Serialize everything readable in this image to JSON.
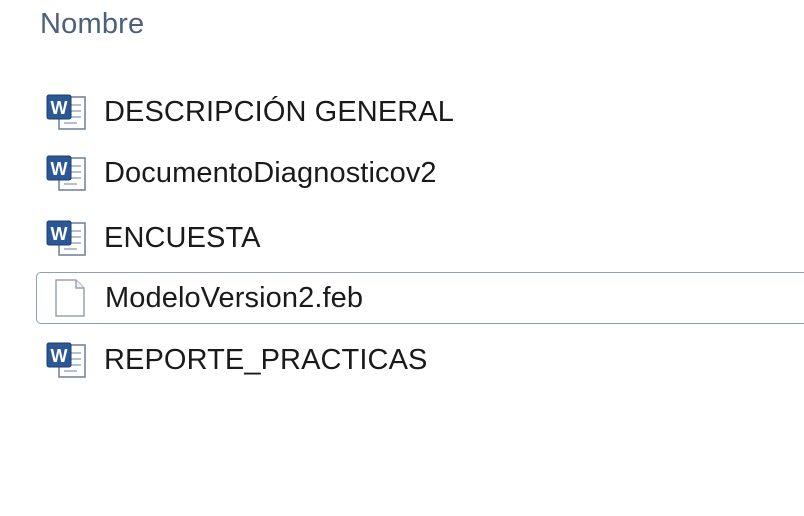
{
  "column_header": {
    "name_label": "Nombre"
  },
  "files": [
    {
      "name": "DESCRIPCIÓN GENERAL",
      "icon": "word-document-icon",
      "selected": false
    },
    {
      "name": "DocumentoDiagnosticov2",
      "icon": "word-document-icon",
      "selected": false
    },
    {
      "name": "ENCUESTA",
      "icon": "word-document-icon",
      "selected": false
    },
    {
      "name": "ModeloVersion2.feb",
      "icon": "generic-file-icon",
      "selected": true
    },
    {
      "name": "REPORTE_PRACTICAS",
      "icon": "word-document-icon",
      "selected": false
    }
  ],
  "colors": {
    "header_text": "#4c607a",
    "selection_border": "#8aa0c0",
    "word_blue": "#2b5797"
  }
}
